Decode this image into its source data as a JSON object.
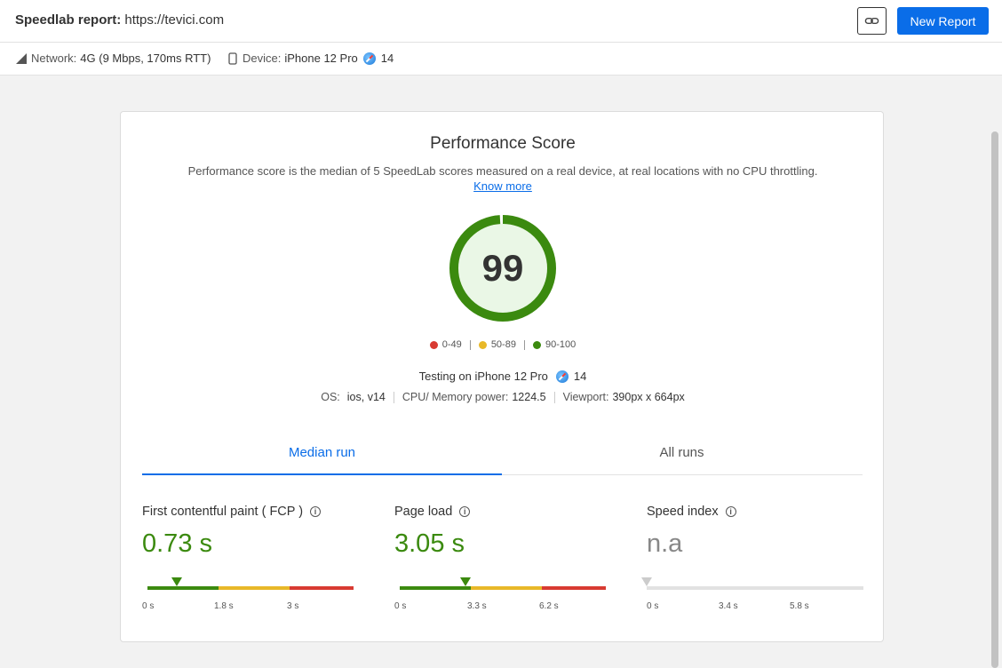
{
  "header": {
    "title_bold": "Speedlab report:",
    "url": "https://tevici.com",
    "new_report_label": "New Report"
  },
  "subbar": {
    "network_label": "Network:",
    "network_value": "4G (9 Mbps, 170ms RTT)",
    "device_label": "Device:",
    "device_value": "iPhone 12 Pro",
    "browser_version": "14"
  },
  "performance": {
    "title": "Performance Score",
    "description": "Performance score is the median of 5 SpeedLab scores measured on a real device, at real locations with no CPU throttling.",
    "know_more": "Know more",
    "score": "99",
    "score_fraction": 0.99,
    "legend": [
      {
        "label": "0-49",
        "color": "#d83a32"
      },
      {
        "label": "50-89",
        "color": "#e8b828"
      },
      {
        "label": "90-100",
        "color": "#3b8a0f"
      }
    ],
    "testing_prefix": "Testing on iPhone 12 Pro",
    "testing_version": "14",
    "os_label": "OS:",
    "os_value": "ios, v14",
    "cpu_label": "CPU/ Memory power:",
    "cpu_value": "1224.5",
    "viewport_label": "Viewport:",
    "viewport_value": "390px x 664px"
  },
  "tabs": [
    {
      "label": "Median run"
    },
    {
      "label": "All runs"
    }
  ],
  "metrics": [
    {
      "label": "First contentful paint ( FCP )",
      "value": "0.73 s",
      "ticks": [
        "0 s",
        "1.8 s",
        "3 s"
      ]
    },
    {
      "label": "Page load",
      "value": "3.05 s",
      "ticks": [
        "0 s",
        "3.3 s",
        "6.2 s"
      ]
    },
    {
      "label": "Speed index",
      "value": "n.a",
      "ticks": [
        "0 s",
        "3.4 s",
        "5.8 s"
      ]
    }
  ],
  "colors": {
    "accent": "#0a6de8",
    "good": "#3b8a0f",
    "average": "#e8b828",
    "poor": "#d83a32"
  }
}
